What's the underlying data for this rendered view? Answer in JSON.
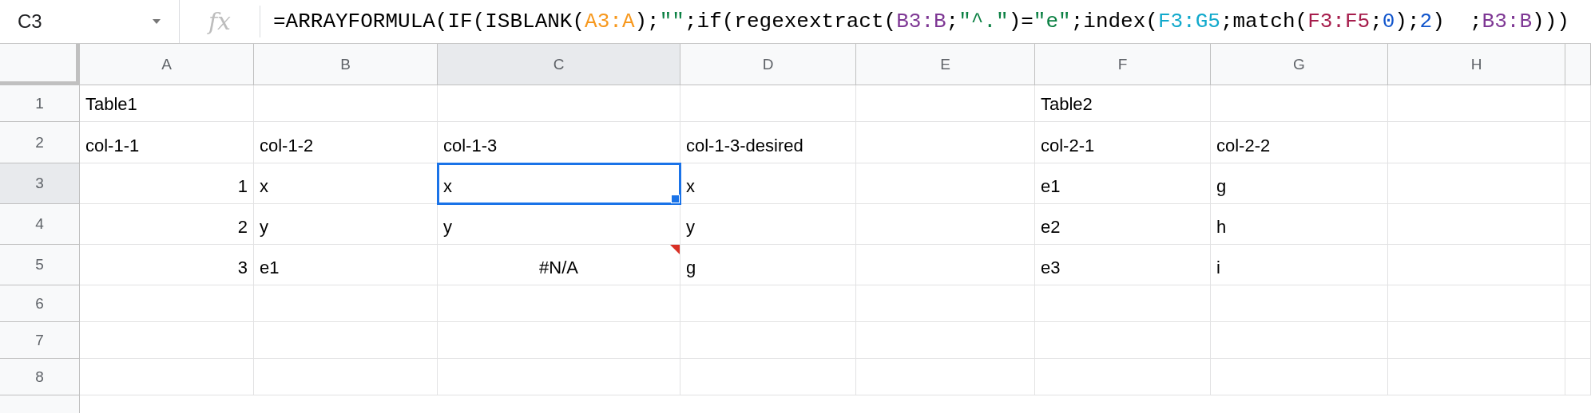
{
  "name_box": {
    "value": "C3"
  },
  "fx_label": "fx",
  "formula": [
    {
      "text": "=ARRAYFORMULA(IF(ISBLANK("
    },
    {
      "text": "A3:A",
      "color": "#f7981d"
    },
    {
      "text": ");"
    },
    {
      "text": "\"\"",
      "color": "#0b8043"
    },
    {
      "text": ";if(regexextract("
    },
    {
      "text": "B3:B",
      "color": "#7e3794"
    },
    {
      "text": ";"
    },
    {
      "text": "\"^.\"",
      "color": "#0b8043"
    },
    {
      "text": ")="
    },
    {
      "text": "\"e\"",
      "color": "#0b8043"
    },
    {
      "text": ";index("
    },
    {
      "text": "F3:G5",
      "color": "#11a9cc"
    },
    {
      "text": ";match("
    },
    {
      "text": "F3:F5",
      "color": "#a61d4c"
    },
    {
      "text": ";"
    },
    {
      "text": "0",
      "color": "#1155cc"
    },
    {
      "text": ");"
    },
    {
      "text": "2",
      "color": "#1155cc"
    },
    {
      "text": ")  ;"
    },
    {
      "text": "B3:B",
      "color": "#7e3794"
    },
    {
      "text": ")))"
    }
  ],
  "columns": [
    {
      "label": "A",
      "selected": false
    },
    {
      "label": "B",
      "selected": false
    },
    {
      "label": "C",
      "selected": true
    },
    {
      "label": "D",
      "selected": false
    },
    {
      "label": "E",
      "selected": false
    },
    {
      "label": "F",
      "selected": false
    },
    {
      "label": "G",
      "selected": false
    },
    {
      "label": "H",
      "selected": false
    },
    {
      "selected": false
    }
  ],
  "rows": [
    {
      "label": "1",
      "selected": false,
      "cells": [
        {
          "text": "Table1",
          "kind": "text",
          "selected": false
        },
        {
          "kind": "empty",
          "selected": false
        },
        {
          "kind": "empty",
          "selected": false
        },
        {
          "kind": "empty",
          "selected": false
        },
        {
          "kind": "empty",
          "selected": false
        },
        {
          "text": "Table2",
          "kind": "text",
          "selected": false
        },
        {
          "kind": "empty",
          "selected": false
        },
        {
          "kind": "empty",
          "selected": false
        },
        {
          "kind": "empty",
          "selected": false
        }
      ]
    },
    {
      "label": "2",
      "selected": false,
      "cells": [
        {
          "text": "col-1-1",
          "kind": "text",
          "selected": false
        },
        {
          "text": "col-1-2",
          "kind": "text",
          "selected": false
        },
        {
          "text": "col-1-3",
          "kind": "text",
          "selected": false
        },
        {
          "text": "col-1-3-desired",
          "kind": "text",
          "selected": false
        },
        {
          "kind": "empty",
          "selected": false
        },
        {
          "text": "col-2-1",
          "kind": "text",
          "selected": false
        },
        {
          "text": "col-2-2",
          "kind": "text",
          "selected": false
        },
        {
          "kind": "empty",
          "selected": false
        },
        {
          "kind": "empty",
          "selected": false
        }
      ]
    },
    {
      "label": "3",
      "selected": true,
      "cells": [
        {
          "text": "1",
          "kind": "number",
          "selected": false
        },
        {
          "text": "x",
          "kind": "text",
          "selected": false
        },
        {
          "text": "x",
          "kind": "text",
          "selected": true
        },
        {
          "text": "x",
          "kind": "text",
          "selected": false
        },
        {
          "kind": "empty",
          "selected": false
        },
        {
          "text": "e1",
          "kind": "text",
          "selected": false
        },
        {
          "text": "g",
          "kind": "text",
          "selected": false
        },
        {
          "kind": "empty",
          "selected": false
        },
        {
          "kind": "empty",
          "selected": false
        }
      ]
    },
    {
      "label": "4",
      "selected": false,
      "cells": [
        {
          "text": "2",
          "kind": "number",
          "selected": false
        },
        {
          "text": "y",
          "kind": "text",
          "selected": false
        },
        {
          "text": "y",
          "kind": "text",
          "selected": false
        },
        {
          "text": "y",
          "kind": "text",
          "selected": false
        },
        {
          "kind": "empty",
          "selected": false
        },
        {
          "text": "e2",
          "kind": "text",
          "selected": false
        },
        {
          "text": "h",
          "kind": "text",
          "selected": false
        },
        {
          "kind": "empty",
          "selected": false
        },
        {
          "kind": "empty",
          "selected": false
        }
      ]
    },
    {
      "label": "5",
      "selected": false,
      "cells": [
        {
          "text": "3",
          "kind": "number",
          "selected": false
        },
        {
          "text": "e1",
          "kind": "text",
          "selected": false
        },
        {
          "text": "#N/A",
          "kind": "error",
          "selected": false
        },
        {
          "text": "g",
          "kind": "text",
          "selected": false
        },
        {
          "kind": "empty",
          "selected": false
        },
        {
          "text": "e3",
          "kind": "text",
          "selected": false
        },
        {
          "text": "i",
          "kind": "text",
          "selected": false
        },
        {
          "kind": "empty",
          "selected": false
        },
        {
          "kind": "empty",
          "selected": false
        }
      ]
    },
    {
      "label": "6",
      "selected": false,
      "cells": [
        {
          "kind": "empty",
          "selected": false
        },
        {
          "kind": "empty",
          "selected": false
        },
        {
          "kind": "empty",
          "selected": false
        },
        {
          "kind": "empty",
          "selected": false
        },
        {
          "kind": "empty",
          "selected": false
        },
        {
          "kind": "empty",
          "selected": false
        },
        {
          "kind": "empty",
          "selected": false
        },
        {
          "kind": "empty",
          "selected": false
        },
        {
          "kind": "empty",
          "selected": false
        }
      ]
    },
    {
      "label": "7",
      "selected": false,
      "cells": [
        {
          "kind": "empty",
          "selected": false
        },
        {
          "kind": "empty",
          "selected": false
        },
        {
          "kind": "empty",
          "selected": false
        },
        {
          "kind": "empty",
          "selected": false
        },
        {
          "kind": "empty",
          "selected": false
        },
        {
          "kind": "empty",
          "selected": false
        },
        {
          "kind": "empty",
          "selected": false
        },
        {
          "kind": "empty",
          "selected": false
        },
        {
          "kind": "empty",
          "selected": false
        }
      ]
    },
    {
      "label": "8",
      "selected": false,
      "cells": [
        {
          "kind": "empty",
          "selected": false
        },
        {
          "kind": "empty",
          "selected": false
        },
        {
          "kind": "empty",
          "selected": false
        },
        {
          "kind": "empty",
          "selected": false
        },
        {
          "kind": "empty",
          "selected": false
        },
        {
          "kind": "empty",
          "selected": false
        },
        {
          "kind": "empty",
          "selected": false
        },
        {
          "kind": "empty",
          "selected": false
        },
        {
          "kind": "empty",
          "selected": false
        }
      ]
    }
  ]
}
